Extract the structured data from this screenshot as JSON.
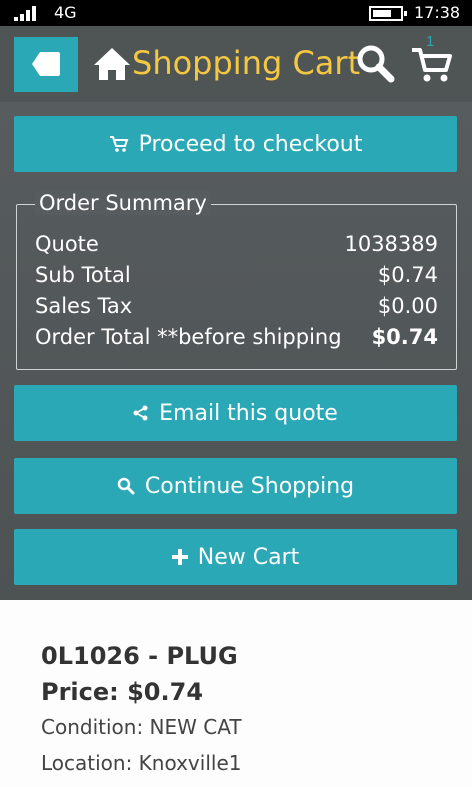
{
  "status_bar": {
    "network": "4G",
    "time": "17:38"
  },
  "header": {
    "title": "Shopping Cart",
    "cart_count": "1"
  },
  "buttons": {
    "checkout": "Proceed to checkout",
    "email": "Email this quote",
    "continue": "Continue Shopping",
    "new_cart": "New Cart"
  },
  "summary": {
    "legend": "Order Summary",
    "rows": [
      {
        "label": "Quote",
        "value": "1038389"
      },
      {
        "label": "Sub Total",
        "value": "$0.74"
      },
      {
        "label": "Sales Tax",
        "value": "$0.00"
      },
      {
        "label": "Order Total **before shipping",
        "value": "$0.74"
      }
    ]
  },
  "item": {
    "title": "0L1026 - PLUG",
    "price": "Price: $0.74",
    "condition": "Condition: NEW CAT",
    "location": "Location: Knoxville1"
  },
  "colors": {
    "accent": "#2ba8b5",
    "title": "#f5c842",
    "header_bg": "#4f5455"
  }
}
